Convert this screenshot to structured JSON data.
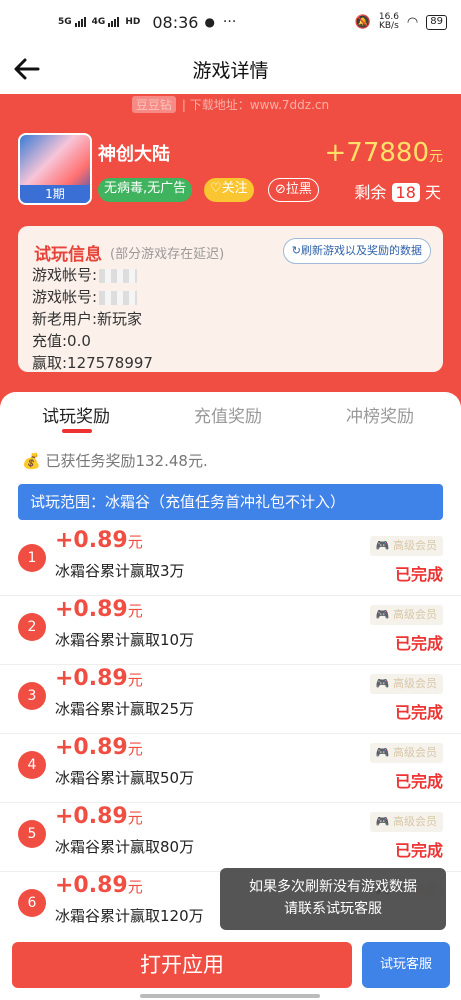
{
  "status_bar": {
    "net1": "5G",
    "net2": "4G",
    "hd": "HD",
    "time": "08:36",
    "more": "···",
    "speed": "16.6\nKB/s",
    "battery": "89"
  },
  "header": {
    "title": "游戏详情"
  },
  "watermark": {
    "logo": "豆豆钻",
    "text": "| 下载地址：www.7ddz.cn"
  },
  "game": {
    "name": "神创大陆",
    "episode": "1期",
    "reward": "+77880",
    "reward_unit": "元",
    "tag_safe": "无病毒,无广告",
    "follow": "♡关注",
    "block": "⊘拉黑",
    "remain_prefix": "剩余",
    "remain_days": "18",
    "remain_suffix": "天"
  },
  "info": {
    "title": "试玩信息",
    "note": "(部分游戏存在延迟)",
    "refresh": "↻刷新游戏以及奖励的数据",
    "account1": "游戏帐号:",
    "account2": "游戏帐号:",
    "user_type": "新老用户:新玩家",
    "recharge": "充值:0.0",
    "win": "赢取:127578997"
  },
  "tabs": [
    {
      "label": "试玩奖励"
    },
    {
      "label": "充值奖励"
    },
    {
      "label": "冲榜奖励"
    }
  ],
  "earned": "已获任务奖励132.48元.",
  "scope": "试玩范围：冰霜谷（充值任务首冲礼包不计入）",
  "tasks": [
    {
      "num": "1",
      "amount": "+0.89",
      "unit": "元",
      "desc": "冰霜谷累计赢取3万",
      "vip": "高级会员",
      "status": "已完成"
    },
    {
      "num": "2",
      "amount": "+0.89",
      "unit": "元",
      "desc": "冰霜谷累计赢取10万",
      "vip": "高级会员",
      "status": "已完成"
    },
    {
      "num": "3",
      "amount": "+0.89",
      "unit": "元",
      "desc": "冰霜谷累计赢取25万",
      "vip": "高级会员",
      "status": "已完成"
    },
    {
      "num": "4",
      "amount": "+0.89",
      "unit": "元",
      "desc": "冰霜谷累计赢取50万",
      "vip": "高级会员",
      "status": "已完成"
    },
    {
      "num": "5",
      "amount": "+0.89",
      "unit": "元",
      "desc": "冰霜谷累计赢取80万",
      "vip": "高级会员",
      "status": "已完成"
    },
    {
      "num": "6",
      "amount": "+0.89",
      "unit": "元",
      "desc": "冰霜谷累计赢取120万",
      "vip": "高级会员",
      "status": ""
    }
  ],
  "tooltip": {
    "line1": "如果多次刷新没有游戏数据",
    "line2": "请联系试玩客服"
  },
  "bottom": {
    "open": "打开应用",
    "service": "试玩客服"
  },
  "colors": {
    "primary_red": "#f04e42",
    "blue": "#3f82e8",
    "gold": "#ffe16a",
    "green": "#3fb35e"
  }
}
